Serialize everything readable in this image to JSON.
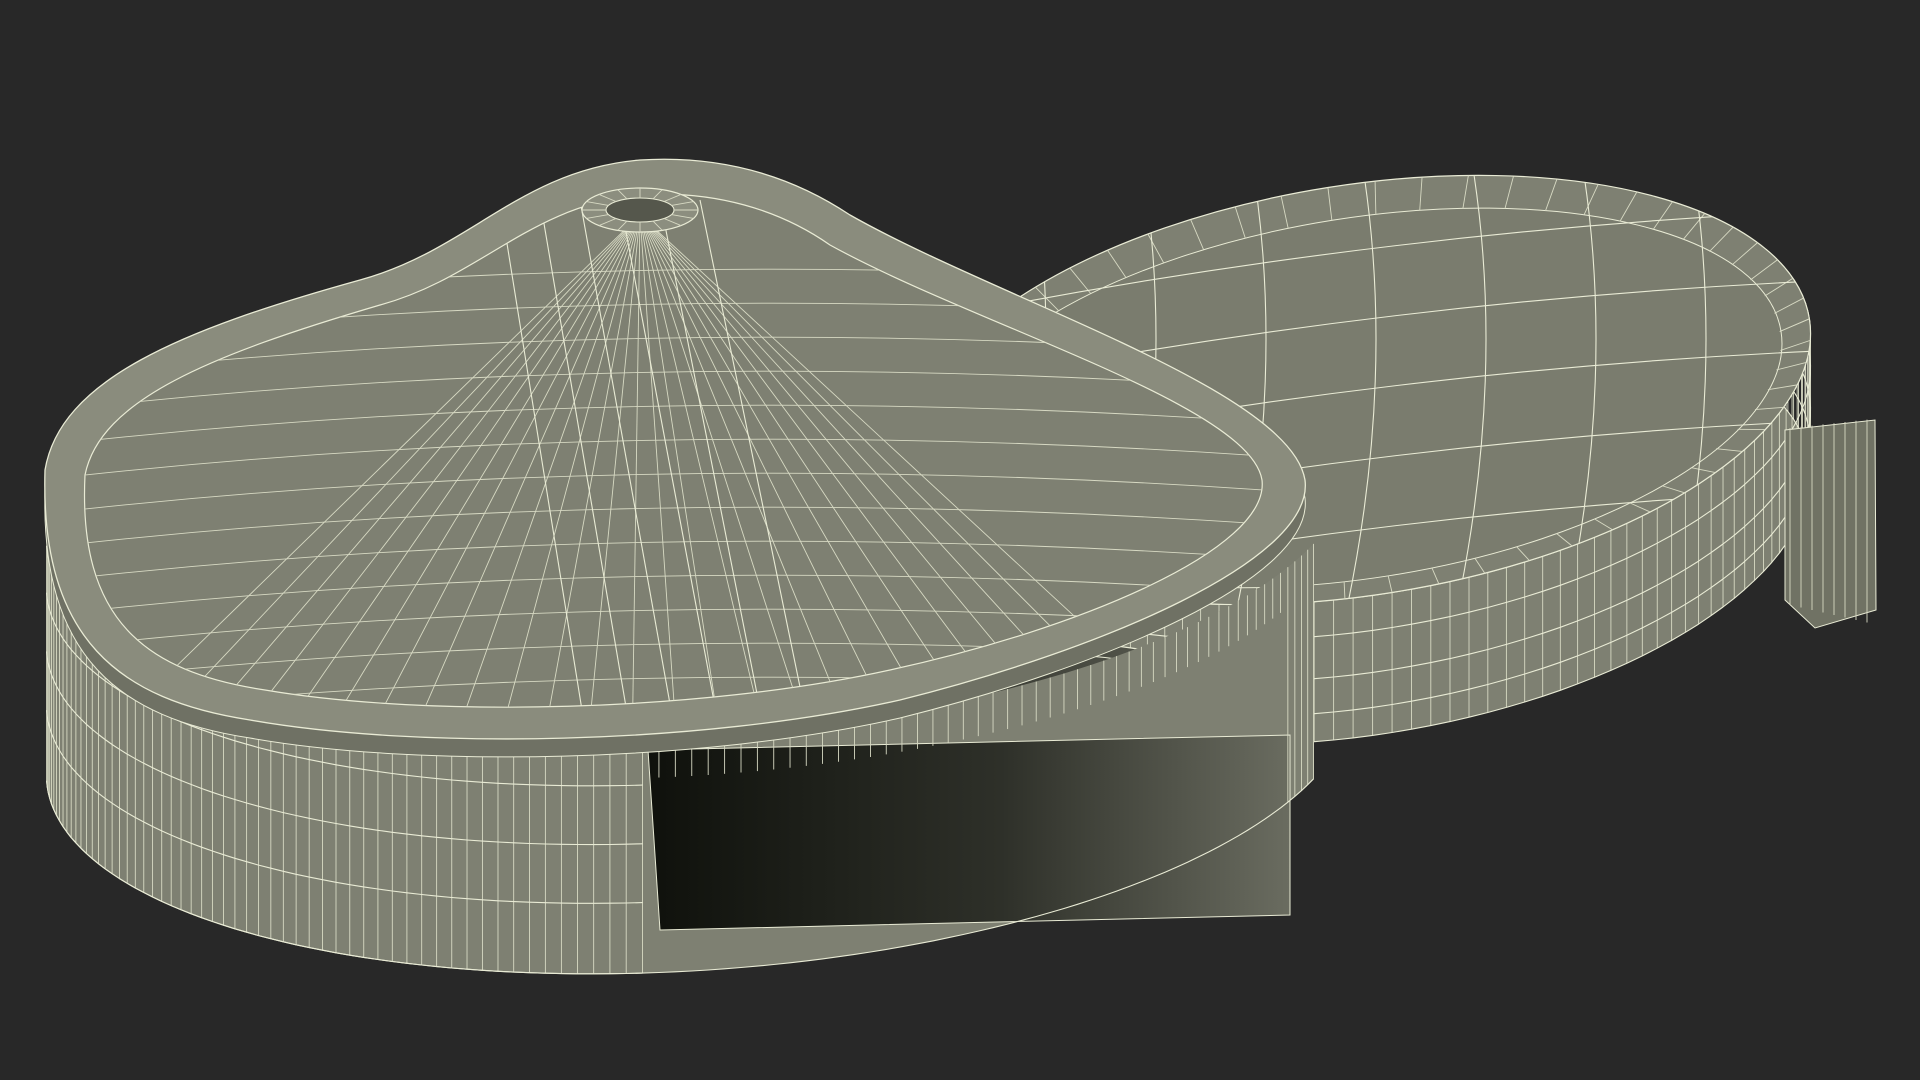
{
  "scene": {
    "background": "#282828",
    "surface_color": "#7e8072",
    "surface_dark": "#5f6155",
    "wire_color": "#e9ebd5",
    "shadow_color": "#15170f"
  }
}
